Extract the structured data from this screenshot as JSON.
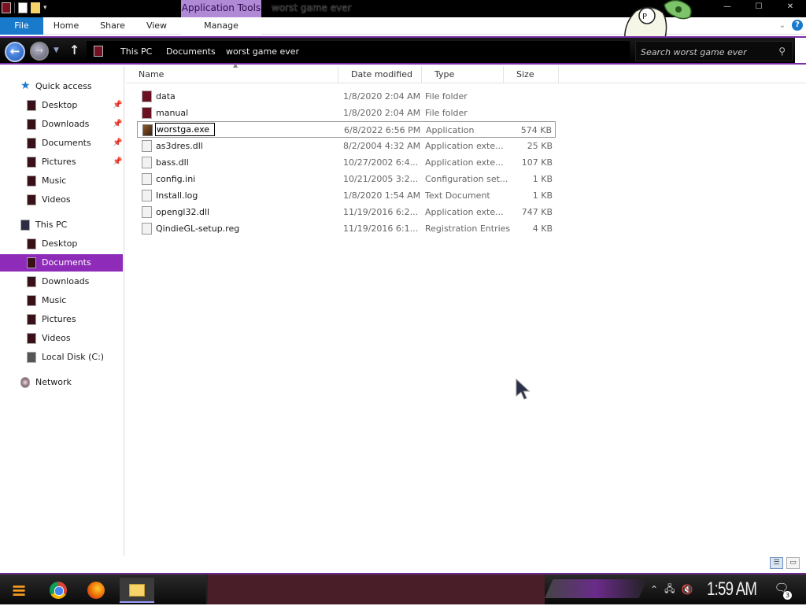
{
  "titlebar": {
    "context_tab": "Application Tools",
    "window_title": "worst game ever",
    "minimize": "—",
    "maximize": "☐",
    "close": "✕"
  },
  "ribbon": {
    "tabs": [
      {
        "label": "File"
      },
      {
        "label": "Home"
      },
      {
        "label": "Share"
      },
      {
        "label": "View"
      },
      {
        "label": "Manage"
      }
    ]
  },
  "address": {
    "breadcrumbs": [
      "This PC",
      "Documents",
      "worst game ever"
    ],
    "search_placeholder": "Search worst game ever"
  },
  "nav": {
    "quick_access": "Quick access",
    "quick_items": [
      {
        "label": "Desktop",
        "pinned": true
      },
      {
        "label": "Downloads",
        "pinned": true
      },
      {
        "label": "Documents",
        "pinned": true
      },
      {
        "label": "Pictures",
        "pinned": true
      },
      {
        "label": "Music",
        "pinned": false
      },
      {
        "label": "Videos",
        "pinned": false
      }
    ],
    "this_pc": "This PC",
    "pc_items": [
      {
        "label": "Desktop"
      },
      {
        "label": "Documents",
        "selected": true
      },
      {
        "label": "Downloads"
      },
      {
        "label": "Music"
      },
      {
        "label": "Pictures"
      },
      {
        "label": "Videos"
      },
      {
        "label": "Local Disk (C:)"
      }
    ],
    "network": "Network"
  },
  "columns": {
    "name": "Name",
    "date": "Date modified",
    "type": "Type",
    "size": "Size"
  },
  "files": [
    {
      "name": "data",
      "date": "1/8/2020 2:04 AM",
      "type": "File folder",
      "size": "",
      "kind": "folder"
    },
    {
      "name": "manual",
      "date": "1/8/2020 2:04 AM",
      "type": "File folder",
      "size": "",
      "kind": "folder"
    },
    {
      "name": "worstga.exe",
      "date": "6/8/2022 6:56 PM",
      "type": "Application",
      "size": "574 KB",
      "kind": "exe",
      "renaming": true
    },
    {
      "name": "as3dres.dll",
      "date": "8/2/2004 4:32 AM",
      "type": "Application exte...",
      "size": "25 KB",
      "kind": "file"
    },
    {
      "name": "bass.dll",
      "date": "10/27/2002 6:4...",
      "type": "Application exte...",
      "size": "107 KB",
      "kind": "file"
    },
    {
      "name": "config.ini",
      "date": "10/21/2005 3:2...",
      "type": "Configuration set...",
      "size": "1 KB",
      "kind": "file"
    },
    {
      "name": "Install.log",
      "date": "1/8/2020 1:54 AM",
      "type": "Text Document",
      "size": "1 KB",
      "kind": "file"
    },
    {
      "name": "opengl32.dll",
      "date": "11/19/2016 6:2...",
      "type": "Application exte...",
      "size": "747 KB",
      "kind": "file"
    },
    {
      "name": "QindieGL-setup.reg",
      "date": "11/19/2016 6:1...",
      "type": "Registration Entries",
      "size": "4 KB",
      "kind": "file"
    }
  ],
  "taskbar": {
    "clock": "1:59 AM",
    "notification_count": "3"
  },
  "icons": {
    "quick_access": "star-icon",
    "this_pc": "computer-icon",
    "network": "network-icon",
    "disk": "drive-icon"
  },
  "colors": {
    "accent": "#8e2bb8",
    "file_tab": "#1979ca",
    "context_tab": "#b18ad6"
  }
}
